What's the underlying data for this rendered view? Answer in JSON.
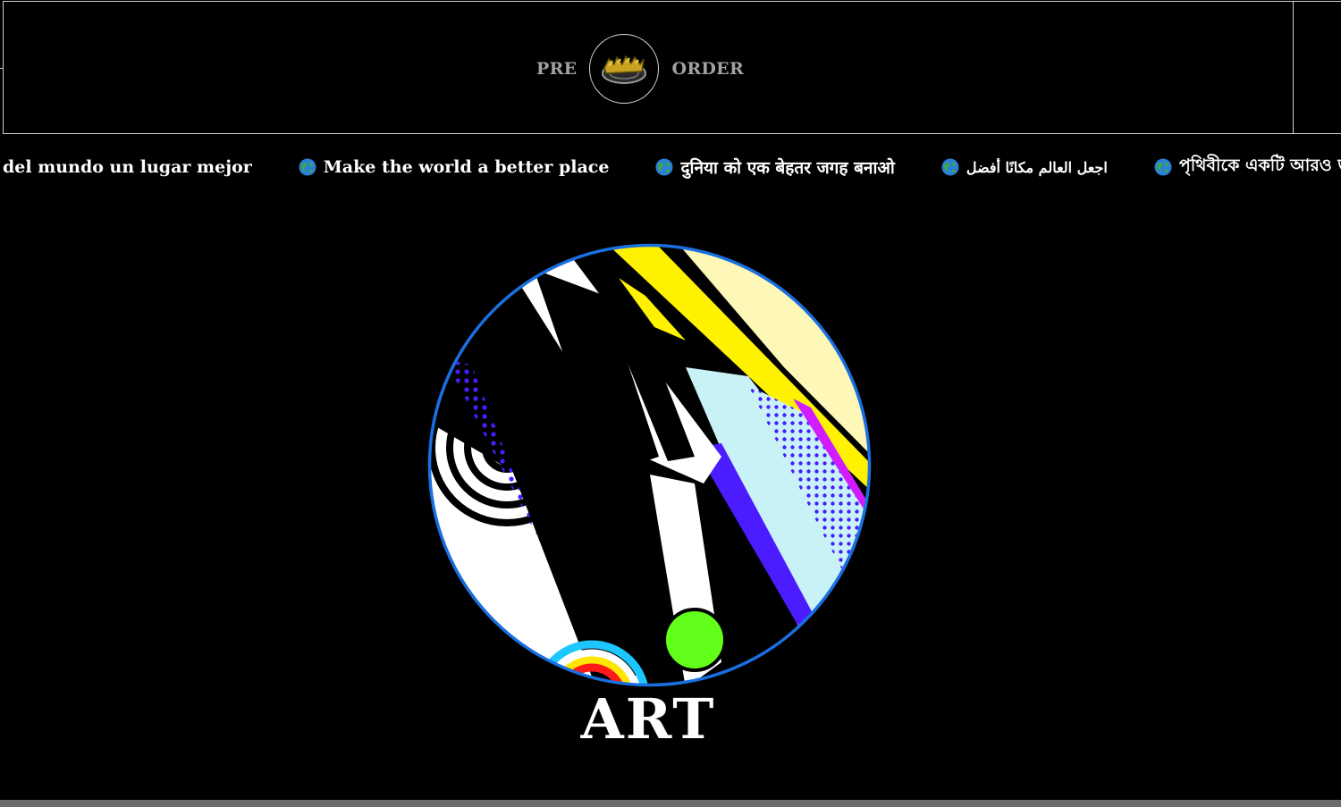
{
  "header": {
    "pre_label": "PRE",
    "order_label": "ORDER",
    "logo_icon": "nope-brand-logo-icon"
  },
  "ticker": {
    "items": [
      {
        "icon": "globe-icon",
        "text": "del mundo un lugar mejor"
      },
      {
        "icon": "globe-icon",
        "text": "Make the world a better place"
      },
      {
        "icon": "globe-icon",
        "text": "दुनिया को एक बेहतर जगह बनाओ"
      },
      {
        "icon": "globe-icon",
        "text": "اجعل العالم مكانًا أفضل"
      },
      {
        "icon": "globe-icon",
        "text": "পৃথিবীকে একটি আরও ভ"
      }
    ]
  },
  "feature": {
    "label": "ART",
    "image": "pop-art-illustration",
    "ring_color": "#1a6fe0"
  },
  "colors": {
    "background": "#000000",
    "header_text": "#a2a2a2",
    "accent_yellow": "#ffe600",
    "accent_purple": "#4b1cff"
  }
}
